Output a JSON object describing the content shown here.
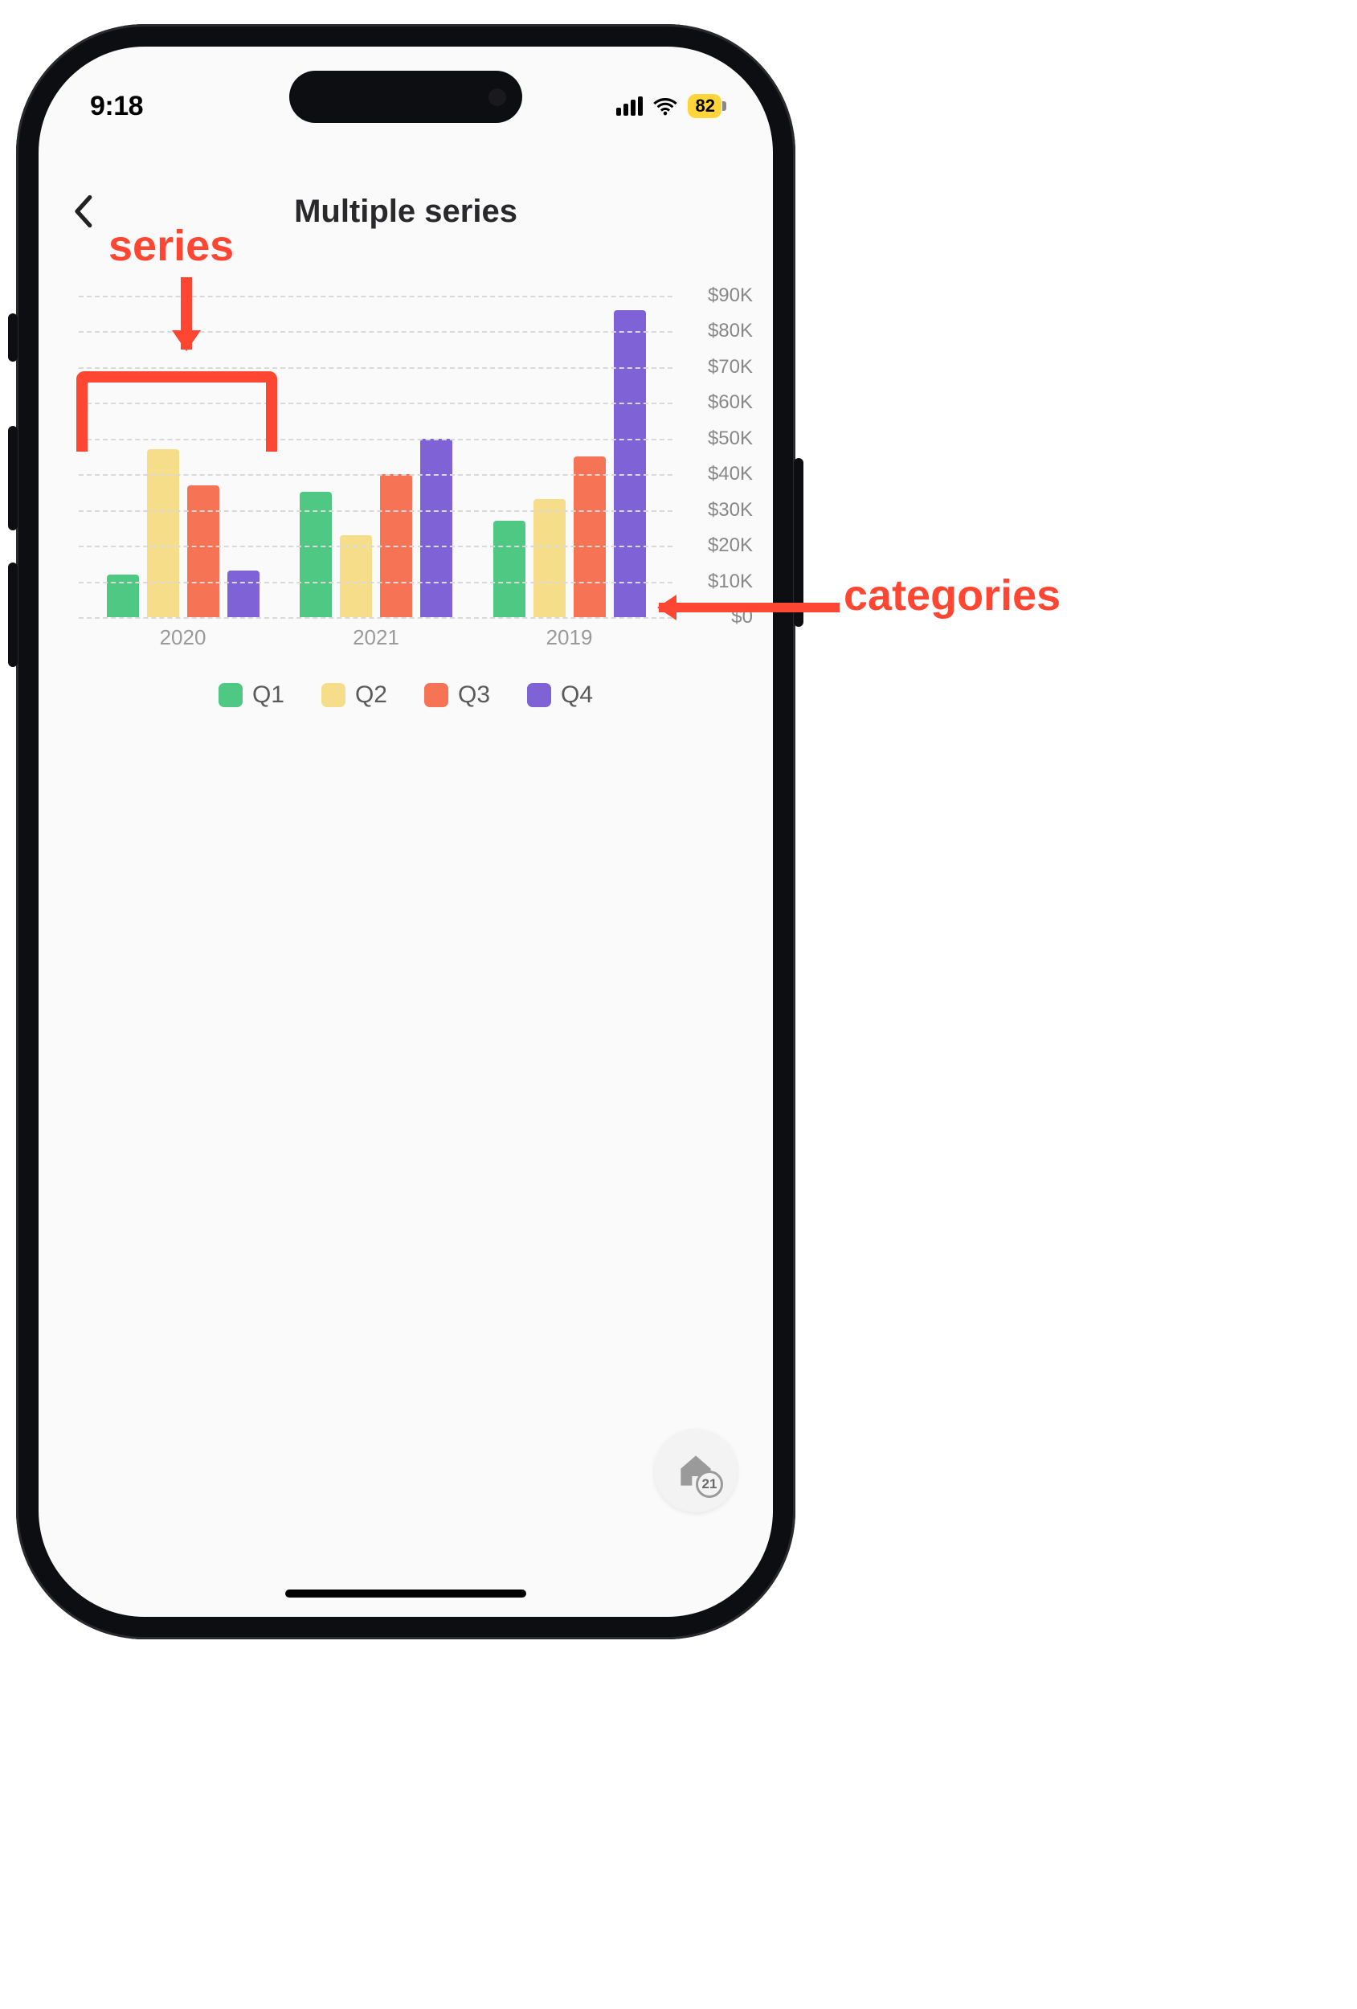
{
  "status_bar": {
    "time": "9:18",
    "battery_percent": "82"
  },
  "header": {
    "title": "Multiple series"
  },
  "chart_data": {
    "type": "bar",
    "categories": [
      "2020",
      "2021",
      "2019"
    ],
    "series": [
      {
        "name": "Q1",
        "color": "#4ec882",
        "values": [
          12000,
          35000,
          27000
        ]
      },
      {
        "name": "Q2",
        "color": "#f5dd89",
        "values": [
          47000,
          23000,
          33000
        ]
      },
      {
        "name": "Q3",
        "color": "#f77355",
        "values": [
          37000,
          40000,
          45000
        ]
      },
      {
        "name": "Q4",
        "color": "#7e62d6",
        "values": [
          13000,
          50000,
          86000
        ]
      }
    ],
    "ylim": [
      0,
      90000
    ],
    "y_ticks": [
      0,
      10000,
      20000,
      30000,
      40000,
      50000,
      60000,
      70000,
      80000,
      90000
    ],
    "y_tick_labels": [
      "$0",
      "$10K",
      "$20K",
      "$30K",
      "$40K",
      "$50K",
      "$60K",
      "$70K",
      "$80K",
      "$90K"
    ],
    "xlabel": "",
    "ylabel": ""
  },
  "home_fab": {
    "badge": "21"
  },
  "annotations": {
    "series_label": "series",
    "categories_label": "categories"
  }
}
